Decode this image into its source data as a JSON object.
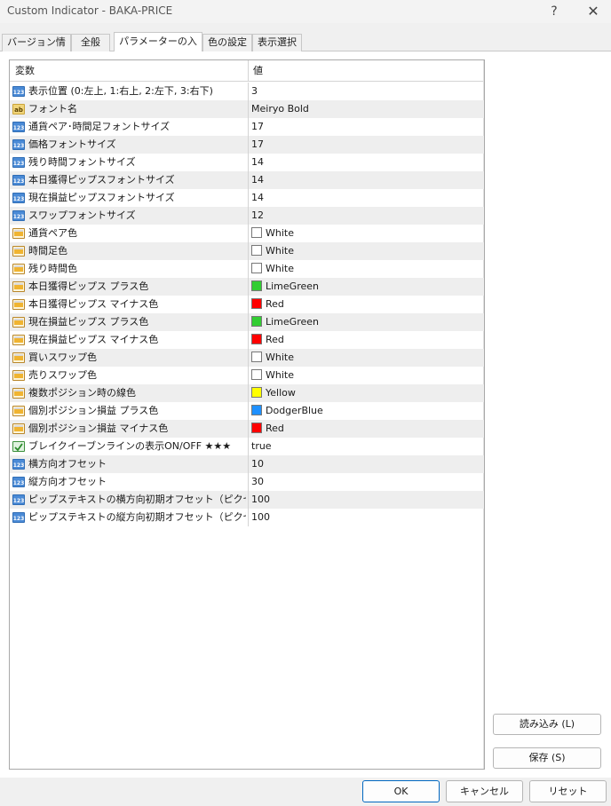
{
  "window": {
    "title": "Custom Indicator - BAKA-PRICE",
    "help_label": "?",
    "close_label": "✕"
  },
  "tabs": [
    {
      "label": "バージョン情報"
    },
    {
      "label": "全般"
    },
    {
      "label": "パラメーターの入力"
    },
    {
      "label": "色の設定"
    },
    {
      "label": "表示選択"
    }
  ],
  "grid": {
    "col_name": "変数",
    "col_value": "値",
    "rows": [
      {
        "name": "表示位置 (0:左上, 1:右上, 2:左下, 3:右下)",
        "value": "3",
        "type": "int"
      },
      {
        "name": "フォント名",
        "value": "Meiryo Bold",
        "type": "string"
      },
      {
        "name": "通貨ペア･時間足フォントサイズ",
        "value": "17",
        "type": "int"
      },
      {
        "name": "価格フォントサイズ",
        "value": "17",
        "type": "int"
      },
      {
        "name": "残り時間フォントサイズ",
        "value": "14",
        "type": "int"
      },
      {
        "name": "本日獲得ピップスフォントサイズ",
        "value": "14",
        "type": "int"
      },
      {
        "name": "現在損益ピップスフォントサイズ",
        "value": "14",
        "type": "int"
      },
      {
        "name": "スワップフォントサイズ",
        "value": "12",
        "type": "int"
      },
      {
        "name": "通貨ペア色",
        "value": "White",
        "type": "color",
        "swatch": "#ffffff"
      },
      {
        "name": "時間足色",
        "value": "White",
        "type": "color",
        "swatch": "#ffffff"
      },
      {
        "name": "残り時間色",
        "value": "White",
        "type": "color",
        "swatch": "#ffffff"
      },
      {
        "name": "本日獲得ピップス プラス色",
        "value": "LimeGreen",
        "type": "color",
        "swatch": "#32cd32"
      },
      {
        "name": "本日獲得ピップス マイナス色",
        "value": "Red",
        "type": "color",
        "swatch": "#ff0000"
      },
      {
        "name": "現在損益ピップス プラス色",
        "value": "LimeGreen",
        "type": "color",
        "swatch": "#32cd32"
      },
      {
        "name": "現在損益ピップス マイナス色",
        "value": "Red",
        "type": "color",
        "swatch": "#ff0000"
      },
      {
        "name": "買いスワップ色",
        "value": "White",
        "type": "color",
        "swatch": "#ffffff"
      },
      {
        "name": "売りスワップ色",
        "value": "White",
        "type": "color",
        "swatch": "#ffffff"
      },
      {
        "name": "複数ポジション時の線色",
        "value": "Yellow",
        "type": "color",
        "swatch": "#ffff00"
      },
      {
        "name": "個別ポジション損益 プラス色",
        "value": "DodgerBlue",
        "type": "color",
        "swatch": "#1e90ff"
      },
      {
        "name": "個別ポジション損益 マイナス色",
        "value": "Red",
        "type": "color",
        "swatch": "#ff0000"
      },
      {
        "name": "ブレイクイーブンラインの表示ON/OFF ★★★",
        "value": "true",
        "type": "bool"
      },
      {
        "name": "横方向オフセット",
        "value": "10",
        "type": "int"
      },
      {
        "name": "縦方向オフセット",
        "value": "30",
        "type": "int"
      },
      {
        "name": "ピップステキストの横方向初期オフセット（ピクセ･..",
        "value": "100",
        "type": "int"
      },
      {
        "name": "ピップステキストの縦方向初期オフセット（ピクセル...",
        "value": "100",
        "type": "int"
      }
    ]
  },
  "buttons": {
    "load": "読み込み (L)",
    "save": "保存 (S)",
    "ok": "OK",
    "cancel": "キャンセル",
    "reset": "リセット"
  },
  "icons": {
    "int": "integer-type-icon",
    "string": "string-type-icon",
    "color": "color-type-icon",
    "bool": "boolean-type-icon"
  }
}
